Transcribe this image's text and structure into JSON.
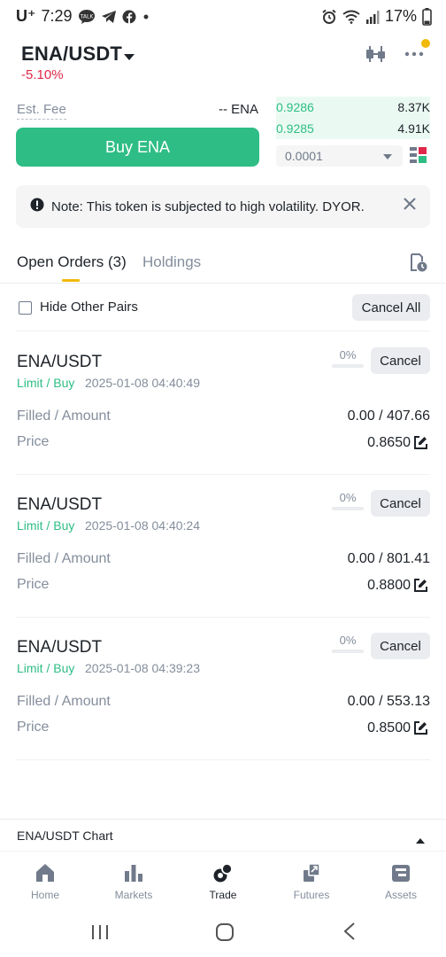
{
  "status_bar": {
    "carrier": "U⁺",
    "time": "7:29",
    "battery": "17%"
  },
  "header": {
    "pair": "ENA/USDT",
    "change": "-5.10%",
    "colors": {
      "negative": "#e0294a",
      "positive": "#2ebd85",
      "accent": "#f0b90b"
    }
  },
  "trade": {
    "fee_label": "Est. Fee",
    "fee_value": "-- ENA",
    "buy_label": "Buy ENA"
  },
  "order_book": {
    "rows": [
      {
        "price": "0.9286",
        "amount": "8.37K"
      },
      {
        "price": "0.9285",
        "amount": "4.91K"
      }
    ],
    "precision": "0.0001"
  },
  "note": {
    "text": "Note: This token is subjected to high volatility. DYOR."
  },
  "tabs": {
    "open_orders": "Open Orders (3)",
    "holdings": "Holdings"
  },
  "filters": {
    "hide_other_pairs": "Hide Other Pairs",
    "cancel_all": "Cancel All"
  },
  "orders": [
    {
      "pair": "ENA/USDT",
      "type": "Limit / Buy",
      "time": "2025-01-08 04:40:49",
      "percent": "0%",
      "cancel": "Cancel",
      "filled_label": "Filled / Amount",
      "filled_value": "0.00 / 407.66",
      "price_label": "Price",
      "price_value": "0.8650"
    },
    {
      "pair": "ENA/USDT",
      "type": "Limit / Buy",
      "time": "2025-01-08 04:40:24",
      "percent": "0%",
      "cancel": "Cancel",
      "filled_label": "Filled / Amount",
      "filled_value": "0.00 / 801.41",
      "price_label": "Price",
      "price_value": "0.8800"
    },
    {
      "pair": "ENA/USDT",
      "type": "Limit / Buy",
      "time": "2025-01-08 04:39:23",
      "percent": "0%",
      "cancel": "Cancel",
      "filled_label": "Filled / Amount",
      "filled_value": "0.00 / 553.13",
      "price_label": "Price",
      "price_value": "0.8500"
    }
  ],
  "chart_bar": {
    "label": "ENA/USDT Chart"
  },
  "bottom_nav": {
    "items": [
      {
        "label": "Home",
        "icon": "home-icon"
      },
      {
        "label": "Markets",
        "icon": "markets-icon"
      },
      {
        "label": "Trade",
        "icon": "trade-icon",
        "active": true
      },
      {
        "label": "Futures",
        "icon": "futures-icon"
      },
      {
        "label": "Assets",
        "icon": "assets-icon"
      }
    ]
  }
}
